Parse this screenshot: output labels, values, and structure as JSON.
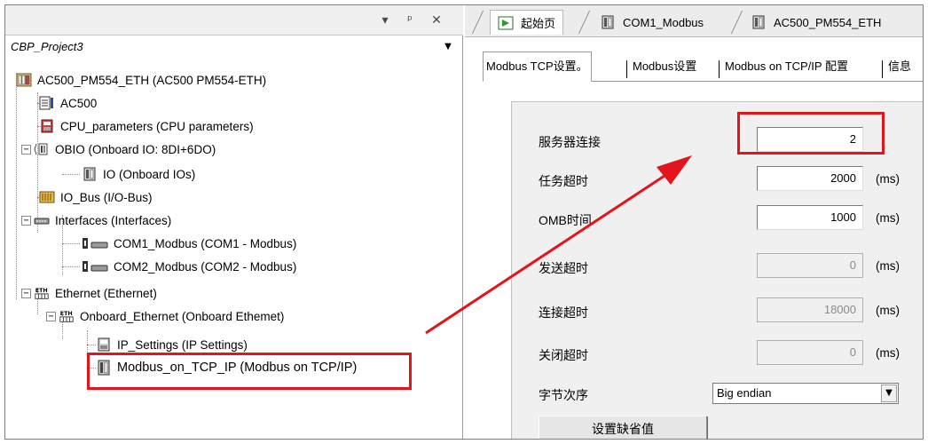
{
  "left_panel": {
    "header_buttons": {
      "dropdown": "▾",
      "pin": "ᵖ",
      "close": "✕"
    },
    "project_name": "CBP_Project3",
    "tree": {
      "plc": "AC500_PM554_ETH (AC500 PM554-ETH)",
      "ac500": "AC500",
      "cpu_parameters": "CPU_parameters (CPU parameters)",
      "obio": "OBIO (Onboard IO: 8DI+6DO)",
      "io": "IO (Onboard IOs)",
      "io_bus": "IO_Bus (I/O-Bus)",
      "interfaces": "Interfaces (Interfaces)",
      "com1": "COM1_Modbus (COM1 - Modbus)",
      "com2": "COM2_Modbus (COM2 - Modbus)",
      "ethernet": "Ethernet (Ethernet)",
      "onboard_ethernet": "Onboard_Ethernet (Onboard Ethemet)",
      "ip_settings": "IP_Settings (IP Settings)",
      "modbus_tcp": "Modbus_on_TCP_IP (Modbus on TCP/IP)"
    },
    "expander_collapse": "−"
  },
  "doc_tabs": [
    {
      "label": "起始页"
    },
    {
      "label": "COM1_Modbus"
    },
    {
      "label": "AC500_PM554_ETH"
    }
  ],
  "sub_tabs": [
    "Modbus TCP设置。",
    "Modbus设置",
    "Modbus on TCP/IP 配置",
    "信息"
  ],
  "settings": {
    "server_connections": {
      "label": "服务器连接",
      "value": "2"
    },
    "task_timeout": {
      "label": "任务超时",
      "value": "2000",
      "unit": "(ms)"
    },
    "omb_time": {
      "label": "OMB时间",
      "value": "1000",
      "unit": "(ms)"
    },
    "send_timeout": {
      "label": "发送超时",
      "value": "0",
      "unit": "(ms)"
    },
    "connect_timeout": {
      "label": "连接超时",
      "value": "18000",
      "unit": "(ms)"
    },
    "close_timeout": {
      "label": "关闭超时",
      "value": "0",
      "unit": "(ms)"
    },
    "byte_order": {
      "label": "字节次序",
      "value": "Big endian",
      "dropdown": "▼"
    },
    "set_default_label": "设置缺省值"
  },
  "colors": {
    "highlight_red": "#e3141b",
    "panel_bg": "#f0f0f0"
  }
}
